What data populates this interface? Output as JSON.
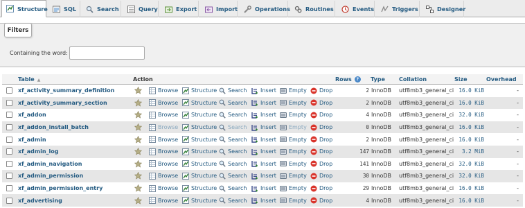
{
  "tabs": [
    {
      "label": "Structure",
      "icon": "structure-icon",
      "active": true
    },
    {
      "label": "SQL",
      "icon": "sql-icon"
    },
    {
      "label": "Search",
      "icon": "search-icon"
    },
    {
      "label": "Query",
      "icon": "query-icon"
    },
    {
      "label": "Export",
      "icon": "export-icon"
    },
    {
      "label": "Import",
      "icon": "import-icon"
    },
    {
      "label": "Operations",
      "icon": "operations-icon"
    },
    {
      "label": "Routines",
      "icon": "routines-icon"
    },
    {
      "label": "Events",
      "icon": "events-icon"
    },
    {
      "label": "Triggers",
      "icon": "triggers-icon"
    },
    {
      "label": "Designer",
      "icon": "designer-icon"
    }
  ],
  "filters": {
    "legend": "Filters",
    "label": "Containing the word:",
    "value": "",
    "placeholder": ""
  },
  "table": {
    "headers": {
      "table": "Table",
      "action": "Action",
      "rows": "Rows",
      "type": "Type",
      "collation": "Collation",
      "size": "Size",
      "overhead": "Overhead"
    },
    "actions": [
      "Browse",
      "Structure",
      "Search",
      "Insert",
      "Empty",
      "Drop"
    ],
    "rows": [
      {
        "name": "xf_activity_summary_definition",
        "rows": "2",
        "type": "InnoDB",
        "collation": "utf8mb3_general_ci",
        "size": "16.0 KiB",
        "overhead": "-",
        "empty": false
      },
      {
        "name": "xf_activity_summary_section",
        "rows": "2",
        "type": "InnoDB",
        "collation": "utf8mb3_general_ci",
        "size": "16.0 KiB",
        "overhead": "-",
        "empty": false
      },
      {
        "name": "xf_addon",
        "rows": "4",
        "type": "InnoDB",
        "collation": "utf8mb3_general_ci",
        "size": "32.0 KiB",
        "overhead": "-",
        "empty": false
      },
      {
        "name": "xf_addon_install_batch",
        "rows": "0",
        "type": "InnoDB",
        "collation": "utf8mb3_general_ci",
        "size": "16.0 KiB",
        "overhead": "-",
        "empty": true
      },
      {
        "name": "xf_admin",
        "rows": "2",
        "type": "InnoDB",
        "collation": "utf8mb3_general_ci",
        "size": "16.0 KiB",
        "overhead": "-",
        "empty": false
      },
      {
        "name": "xf_admin_log",
        "rows": "147",
        "type": "InnoDB",
        "collation": "utf8mb3_general_ci",
        "size": "3.2 MiB",
        "overhead": "-",
        "empty": false
      },
      {
        "name": "xf_admin_navigation",
        "rows": "141",
        "type": "InnoDB",
        "collation": "utf8mb3_general_ci",
        "size": "32.0 KiB",
        "overhead": "-",
        "empty": false
      },
      {
        "name": "xf_admin_permission",
        "rows": "30",
        "type": "InnoDB",
        "collation": "utf8mb3_general_ci",
        "size": "32.0 KiB",
        "overhead": "-",
        "empty": false
      },
      {
        "name": "xf_admin_permission_entry",
        "rows": "29",
        "type": "InnoDB",
        "collation": "utf8mb3_general_ci",
        "size": "16.0 KiB",
        "overhead": "-",
        "empty": false
      },
      {
        "name": "xf_advertising",
        "rows": "4",
        "type": "InnoDB",
        "collation": "utf8mb3_general_ci",
        "size": "16.0 KiB",
        "overhead": "-",
        "empty": false
      }
    ]
  },
  "colors": {
    "link": "#235a81",
    "row_alt": "#e6e6e6",
    "drop": "#d9342b",
    "star": "#a09a76"
  }
}
